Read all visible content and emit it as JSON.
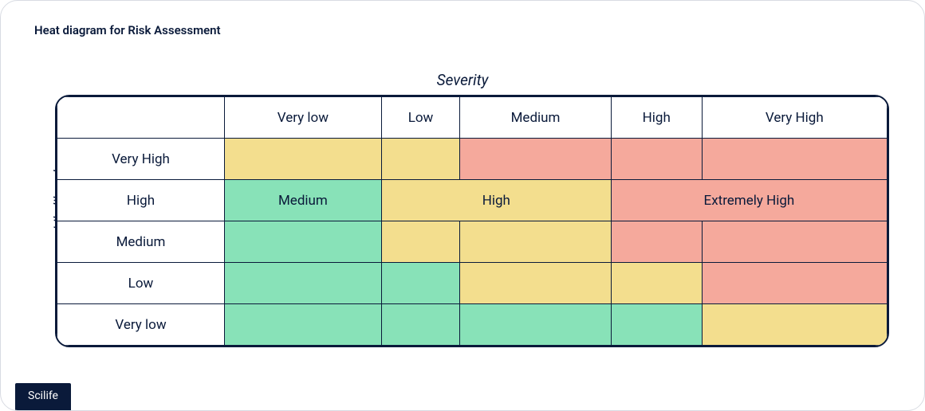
{
  "title": "Heat diagram for Risk Assessment",
  "axes": {
    "x_label": "Severity",
    "y_label": "Likelihood"
  },
  "severity_levels": [
    "Very low",
    "Low",
    "Medium",
    "High",
    "Very High"
  ],
  "likelihood_levels": [
    "Very High",
    "High",
    "Medium",
    "Low",
    "Very low"
  ],
  "legend": {
    "green_label": "Medium",
    "yellow_label": "High",
    "red_label": "Extremely High"
  },
  "colors": {
    "green": "#88e2b8",
    "yellow": "#f3de8e",
    "red": "#f5a99c",
    "border": "#0a1a3a"
  },
  "cells": [
    [
      "yellow",
      "yellow",
      "red",
      "red",
      "red"
    ],
    [
      "green",
      "yellow",
      "yellow",
      "red",
      "red"
    ],
    [
      "green",
      "yellow",
      "yellow",
      "red",
      "red"
    ],
    [
      "green",
      "green",
      "yellow",
      "yellow",
      "red"
    ],
    [
      "green",
      "green",
      "green",
      "green",
      "yellow"
    ]
  ],
  "brand": "Scilife",
  "chart_data": {
    "type": "heatmap",
    "x_axis": "Severity",
    "y_axis": "Likelihood",
    "x_categories": [
      "Very low",
      "Low",
      "Medium",
      "High",
      "Very High"
    ],
    "y_categories": [
      "Very High",
      "High",
      "Medium",
      "Low",
      "Very low"
    ],
    "value_labels": {
      "green": "Medium",
      "yellow": "High",
      "red": "Extremely High"
    },
    "matrix": [
      [
        "yellow",
        "yellow",
        "red",
        "red",
        "red"
      ],
      [
        "green",
        "yellow",
        "yellow",
        "red",
        "red"
      ],
      [
        "green",
        "yellow",
        "yellow",
        "red",
        "red"
      ],
      [
        "green",
        "green",
        "yellow",
        "yellow",
        "red"
      ],
      [
        "green",
        "green",
        "green",
        "green",
        "yellow"
      ]
    ]
  }
}
